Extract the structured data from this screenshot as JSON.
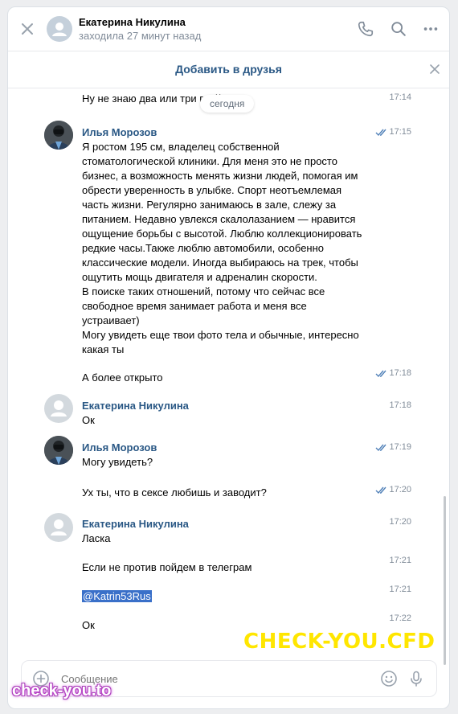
{
  "header": {
    "contact_name": "Екатерина Никулина",
    "status": "заходила 27 минут назад"
  },
  "friend_bar": {
    "add_label": "Добавить в друзья"
  },
  "date_separator": "сегодня",
  "messages": [
    {
      "text": "Ну не знаю два или три г... ((",
      "time": "17:14"
    },
    {
      "author": "Илья Морозов",
      "time": "17:15",
      "lines": [
        "Я ростом 195 см, владелец собственной",
        "стоматологической клиники. Для меня это не просто",
        "бизнес, а возможность менять жизни людей, помогая им",
        "обрести уверенность в улыбке. Спорт неотъемлемая",
        "часть жизни. Регулярно занимаюсь в зале, слежу за",
        "питанием. Недавно увлекся скалолазанием — нравится",
        "ощущение борьбы с высотой. Люблю коллекционировать",
        "редкие часы.Также люблю автомобили, особенно",
        "классические модели. Иногда выбираюсь на трек, чтобы",
        "ощутить мощь двигателя и адреналин скорости.",
        "В поиске таких отношений, потому что сейчас все",
        "свободное время занимает работа и меня все",
        "устраивает)",
        "Могу увидеть еще твои фото тела и обычные, интересно",
        "какая ты"
      ]
    },
    {
      "text": "А более открыто",
      "time": "17:18"
    },
    {
      "author": "Екатерина Никулина",
      "text": "Ок",
      "time": "17:18"
    },
    {
      "author": "Илья Морозов",
      "text": "Могу увидеть?",
      "time": "17:19"
    },
    {
      "text": "Ух ты, что в сексе любишь и заводит?",
      "time": "17:20"
    },
    {
      "author": "Екатерина Никулина",
      "text": "Ласка",
      "time": "17:20"
    },
    {
      "text": "Если не против пойдем в телеграм",
      "time": "17:21"
    },
    {
      "text": "@Katrin53Rus",
      "time": "17:21"
    },
    {
      "text": "Ок",
      "time": "17:22"
    }
  ],
  "composer": {
    "placeholder": "Сообщение"
  },
  "watermarks": {
    "main": "CHECK-YOU.CFD",
    "corner": "check-you.to"
  },
  "colors": {
    "link_blue": "#2a5885",
    "read_check": "#5181b8",
    "watermark_yellow": "#ffe600",
    "page_bg": "#edeef0"
  }
}
